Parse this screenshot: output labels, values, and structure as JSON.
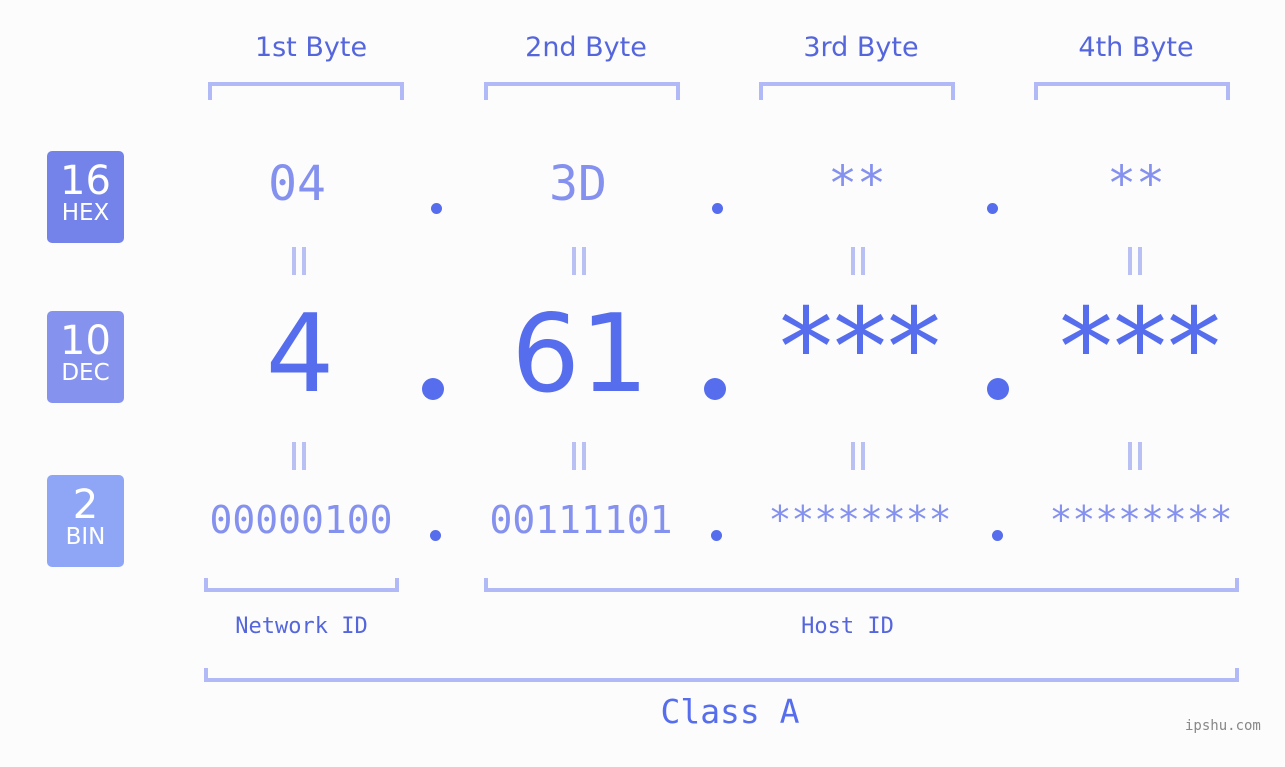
{
  "byte_headers": [
    "1st Byte",
    "2nd Byte",
    "3rd Byte",
    "4th Byte"
  ],
  "badges": [
    {
      "num": "16",
      "label": "HEX",
      "color": "#7383ea"
    },
    {
      "num": "10",
      "label": "DEC",
      "color": "#8593ef"
    },
    {
      "num": "2",
      "label": "BIN",
      "color": "#8fa6f7"
    }
  ],
  "hex": [
    "04",
    "3D",
    "**",
    "**"
  ],
  "dec": [
    "4",
    "61",
    "***",
    "***"
  ],
  "bin": [
    "00000100",
    "00111101",
    "********",
    "********"
  ],
  "network_label": "Network ID",
  "host_label": "Host ID",
  "class_label": "Class A",
  "watermark": "ipshu.com",
  "colors": {
    "accent": "#566ded",
    "light": "#8591ee",
    "bracket": "#b1b9f6"
  }
}
